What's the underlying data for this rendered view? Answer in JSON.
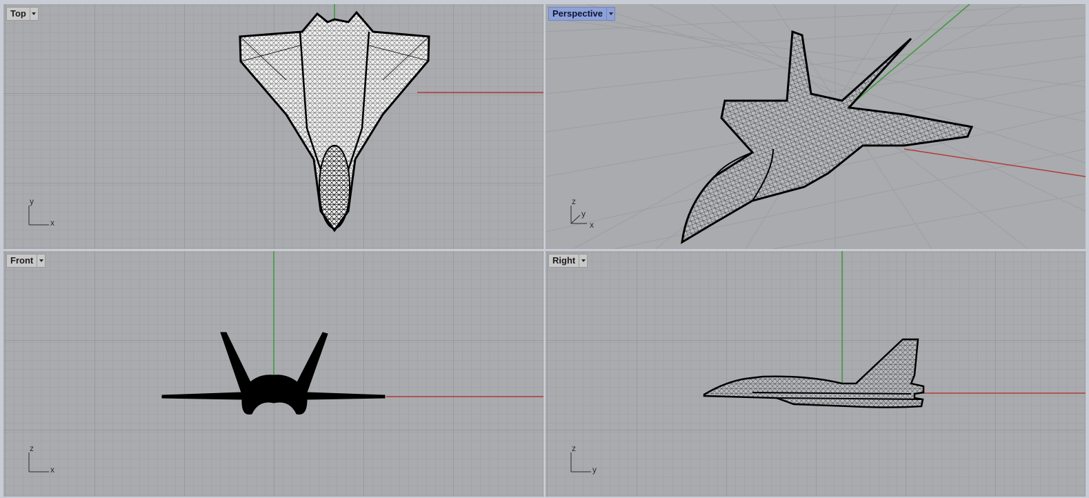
{
  "viewports": {
    "top": {
      "title": "Top",
      "axis_a": "y",
      "axis_b": "x"
    },
    "perspective": {
      "title": "Perspective",
      "axis_a": "z",
      "axis_b": "y",
      "axis_c": "x"
    },
    "front": {
      "title": "Front",
      "axis_a": "z",
      "axis_b": "x"
    },
    "right": {
      "title": "Right",
      "axis_a": "z",
      "axis_b": "y"
    }
  },
  "colors": {
    "background": "#a9abaf",
    "grid_minor": "#9c9ea2",
    "grid_major": "#8d8f93",
    "x_axis": "#b33a35",
    "y_axis": "#3a9a3a",
    "active_label": "#8ea2d8",
    "wireframe": "#000000"
  },
  "icons": {
    "viewport_menu": "chevron-down-icon",
    "axis_widget": "axis-triad-icon"
  }
}
